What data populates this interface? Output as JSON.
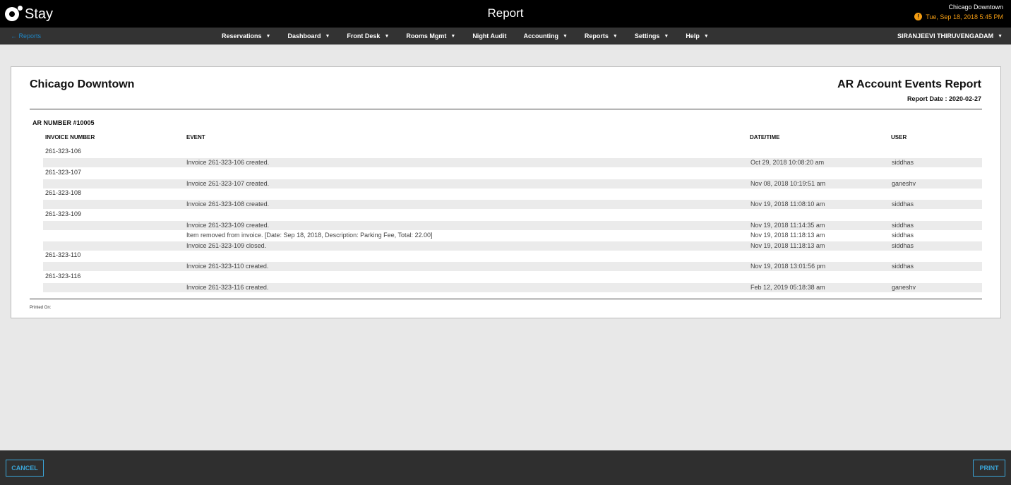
{
  "header": {
    "logo_text": "Stay",
    "title": "Report",
    "hotel_name": "Chicago Downtown",
    "datetime": "Tue, Sep 18, 2018 5:45 PM"
  },
  "nav": {
    "back_label": "← Reports",
    "items": [
      {
        "label": "Reservations",
        "dropdown": true
      },
      {
        "label": "Dashboard",
        "dropdown": true
      },
      {
        "label": "Front Desk",
        "dropdown": true
      },
      {
        "label": "Rooms Mgmt",
        "dropdown": true
      },
      {
        "label": "Night Audit",
        "dropdown": false
      },
      {
        "label": "Accounting",
        "dropdown": true
      },
      {
        "label": "Reports",
        "dropdown": true
      },
      {
        "label": "Settings",
        "dropdown": true
      },
      {
        "label": "Help",
        "dropdown": true
      }
    ],
    "user_name": "SIRANJEEVI THIRUVENGADAM"
  },
  "report": {
    "hotel_name": "Chicago Downtown",
    "title": "AR Account Events Report",
    "report_date": "Report Date : 2020-02-27",
    "ar_number": "AR NUMBER #10005",
    "columns": {
      "invoice": "INVOICE NUMBER",
      "event": "EVENT",
      "datetime": "DATE/TIME",
      "user": "USER"
    },
    "invoices": [
      {
        "number": "261-323-106",
        "events": [
          {
            "event": "Invoice 261-323-106 created.",
            "datetime": "Oct 29, 2018 10:08:20 am",
            "user": "siddhas"
          }
        ]
      },
      {
        "number": "261-323-107",
        "events": [
          {
            "event": "Invoice 261-323-107 created.",
            "datetime": "Nov 08, 2018 10:19:51 am",
            "user": "ganeshv"
          }
        ]
      },
      {
        "number": "261-323-108",
        "events": [
          {
            "event": "Invoice 261-323-108 created.",
            "datetime": "Nov 19, 2018 11:08:10 am",
            "user": "siddhas"
          }
        ]
      },
      {
        "number": "261-323-109",
        "events": [
          {
            "event": "Invoice 261-323-109 created.",
            "datetime": "Nov 19, 2018 11:14:35 am",
            "user": "siddhas"
          },
          {
            "event": "Item removed from invoice. [Date: Sep 18, 2018, Description: Parking Fee, Total: 22.00]",
            "datetime": "Nov 19, 2018 11:18:13 am",
            "user": "siddhas"
          },
          {
            "event": "Invoice 261-323-109 closed.",
            "datetime": "Nov 19, 2018 11:18:13 am",
            "user": "siddhas"
          }
        ]
      },
      {
        "number": "261-323-110",
        "events": [
          {
            "event": "Invoice 261-323-110 created.",
            "datetime": "Nov 19, 2018 13:01:56 pm",
            "user": "siddhas"
          }
        ]
      },
      {
        "number": "261-323-116",
        "events": [
          {
            "event": "Invoice 261-323-116 created.",
            "datetime": "Feb 12, 2019 05:18:38 am",
            "user": "ganeshv"
          }
        ]
      }
    ],
    "printed_on": "Printed On:"
  },
  "footer": {
    "cancel_label": "CANCEL",
    "print_label": "PRINT"
  },
  "colors": {
    "accent": "#3aa6d9",
    "warning": "#f39c12"
  }
}
